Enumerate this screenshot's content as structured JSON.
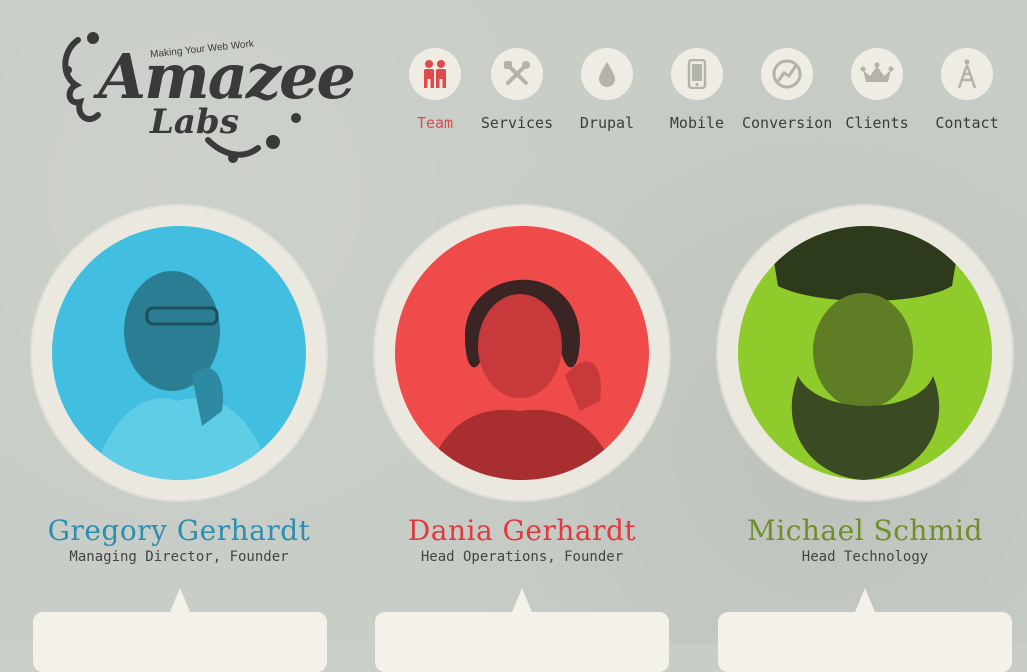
{
  "logo": {
    "tagline": "Making Your Web Work",
    "word1": "Amazee",
    "word2": "Labs"
  },
  "nav": [
    {
      "label": "Team",
      "icon": "team-icon",
      "active": true
    },
    {
      "label": "Services",
      "icon": "tools-icon",
      "active": false
    },
    {
      "label": "Drupal",
      "icon": "drop-icon",
      "active": false
    },
    {
      "label": "Mobile",
      "icon": "phone-icon",
      "active": false
    },
    {
      "label": "Conversion",
      "icon": "chart-icon",
      "active": false
    },
    {
      "label": "Clients",
      "icon": "crown-icon",
      "active": false
    },
    {
      "label": "Contact",
      "icon": "antenna-icon",
      "active": false
    }
  ],
  "team": [
    {
      "name": "Gregory Gerhardt",
      "role": "Managing Director, Founder",
      "color": "#2b8fb1",
      "bg": "#42bfe0"
    },
    {
      "name": "Dania Gerhardt",
      "role": "Head Operations, Founder",
      "color": "#e0393e",
      "bg": "#ef4b4b"
    },
    {
      "name": "Michael Schmid",
      "role": "Head Technology",
      "color": "#6f8f2a",
      "bg": "#8fcb2a"
    }
  ],
  "colors": {
    "accent": "#e04a4a",
    "background": "#c9cdc7",
    "paper": "#ebe9df"
  }
}
